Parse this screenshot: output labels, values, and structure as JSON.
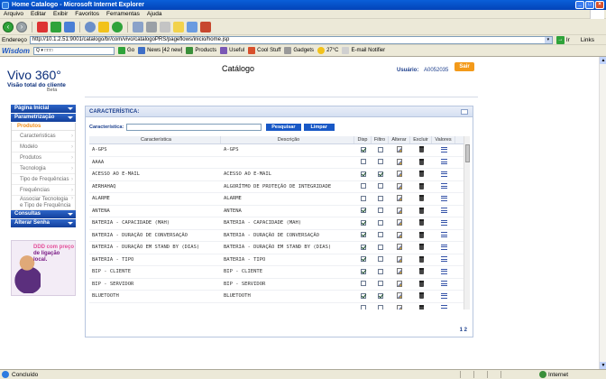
{
  "window": {
    "title": "Home Catalogo - Microsoft Internet Explorer"
  },
  "menu": [
    "Arquivo",
    "Editar",
    "Exibir",
    "Favoritos",
    "Ferramentas",
    "Ajuda"
  ],
  "address": {
    "label": "Endereço",
    "url": "http://10.1.2.51:9001/catalogo/br/com/vivo/catalogoPRS/pageflows/inicio/home.jsp",
    "go_label": "Ir",
    "links_label": "Links"
  },
  "linksbar": {
    "wisdom": "Wisdom",
    "go": "Go",
    "news": "News [42 new]",
    "products": "Products",
    "useful": "Useful",
    "cool_stuff": "Cool Stuff",
    "gadgets": "Gadgets",
    "temp": "27°C",
    "email_notifier": "E-mail Notifier"
  },
  "brand": {
    "title_word": "Vivo",
    "title_num": "360°",
    "subtitle": "Visão total do cliente",
    "beta": "Beta"
  },
  "header": {
    "page_title": "Catálogo",
    "user_label": "Usuário:",
    "user_id": "A0052035",
    "logout": "Sair"
  },
  "sidebar": {
    "head_home": "Página Inicial",
    "head_param": "Parametrização",
    "sub_products": "Produtos",
    "items": [
      "Caracteristicas",
      "Modelo",
      "Produtos",
      "Tecnologia",
      "Tipo de Frequências",
      "Frequências"
    ],
    "item_assoc_1": "Associar Tecnologia",
    "item_assoc_2": "e Tipo de Frequência",
    "head_consultas": "Consultas",
    "head_senha": "Alterar Senha",
    "promo_1": "DDD com preço",
    "promo_2": "de ligação local."
  },
  "panel": {
    "title": "CARACTERÍSTICA:",
    "search_label": "Característica:",
    "search_value": "",
    "btn_search": "Pesquisar",
    "btn_clear": "Limpar",
    "columns": [
      "Característica",
      "Descrição",
      "Disp",
      "Filtro",
      "Alterar",
      "Excluir",
      "Valores"
    ],
    "rows": [
      {
        "car": "A-GPS",
        "desc": "A-GPS",
        "disp": true,
        "filtro": false
      },
      {
        "car": "AAAA",
        "desc": "",
        "disp": false,
        "filtro": false
      },
      {
        "car": "ACESSO AO E-MAIL",
        "desc": "ACESSO AO E-MAIL",
        "disp": true,
        "filtro": true
      },
      {
        "car": "AERHAHAQ",
        "desc": "ALGORÍTMO DE PROTEÇÃO DE INTEGRIDADE",
        "disp": false,
        "filtro": false
      },
      {
        "car": "ALARME",
        "desc": "ALARME",
        "disp": false,
        "filtro": false
      },
      {
        "car": "ANTENA",
        "desc": "ANTENA",
        "disp": true,
        "filtro": false
      },
      {
        "car": "BATERIA - CAPACIDADE (MAH)",
        "desc": "BATERIA - CAPACIDADE (MAH)",
        "disp": true,
        "filtro": false
      },
      {
        "car": "BATERIA - DURAÇÃO DE CONVERSAÇÃO",
        "desc": "BATERIA - DURAÇÃO DE CONVERSAÇÃO",
        "disp": true,
        "filtro": false
      },
      {
        "car": "BATERIA - DURAÇÃO EM STAND BY (DIAS)",
        "desc": "BATERIA - DURAÇÃO EM STAND BY (DIAS)",
        "disp": true,
        "filtro": false
      },
      {
        "car": "BATERIA - TIPO",
        "desc": "BATERIA - TIPO",
        "disp": true,
        "filtro": false
      },
      {
        "car": "BIP - CLIENTE",
        "desc": "BIP - CLIENTE",
        "disp": true,
        "filtro": false
      },
      {
        "car": "BIP - SERVIDOR",
        "desc": "BIP - SERVIDOR",
        "disp": false,
        "filtro": false
      },
      {
        "car": "BLUETOOTH",
        "desc": "BLUETOOTH",
        "disp": true,
        "filtro": true
      },
      {
        "car": "",
        "desc": "",
        "disp": false,
        "filtro": false
      }
    ],
    "pager": "1 2"
  },
  "status": {
    "text": "Concluído",
    "zone": "Internet"
  }
}
